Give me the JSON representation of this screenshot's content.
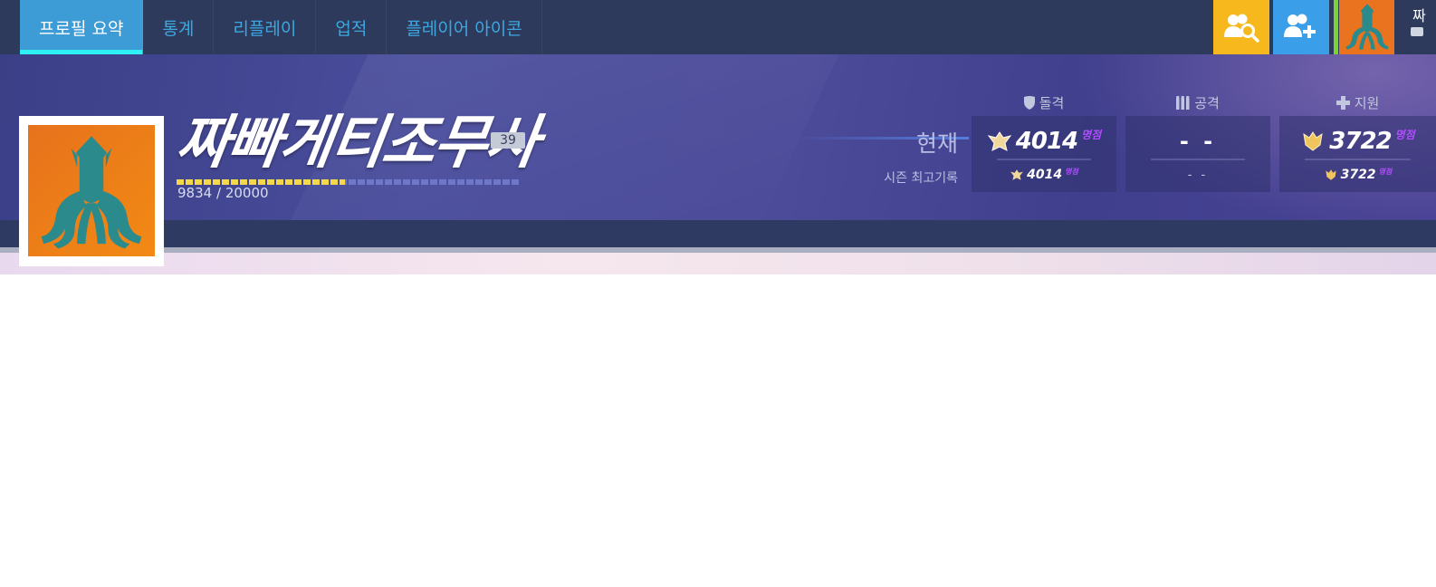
{
  "nav": {
    "tabs": [
      {
        "label": "프로필 요약",
        "active": true
      },
      {
        "label": "통계",
        "active": false
      },
      {
        "label": "리플레이",
        "active": false
      },
      {
        "label": "업적",
        "active": false
      },
      {
        "label": "플레이어 아이콘",
        "active": false
      }
    ]
  },
  "topbar": {
    "user_name_partial": "짜",
    "colors": {
      "search_button": "#f6b81d",
      "add_friend_button": "#3a9ee8",
      "online_status": "#7bd233"
    }
  },
  "profile": {
    "name": "짜빠게티조무사",
    "level": "39",
    "xp_current": "9834",
    "xp_separator": "/",
    "xp_total": "20000",
    "xp_progress": 0.4917,
    "icon": "kraken-icon"
  },
  "competitive": {
    "row_labels": {
      "current": "현재",
      "season_best": "시즌 최고기록"
    },
    "roles": [
      {
        "name": "돌격",
        "icon": "shield-icon",
        "current": "4014",
        "current_tier": "명점",
        "best": "4014",
        "best_tier": "명점",
        "rank_icon": "grandmaster-rank-icon"
      },
      {
        "name": "공격",
        "icon": "ammo-icon",
        "current": "- -",
        "current_tier": "",
        "best": "- -",
        "best_tier": "",
        "rank_icon": ""
      },
      {
        "name": "지원",
        "icon": "cross-icon",
        "current": "3722",
        "current_tier": "명점",
        "best": "3722",
        "best_tier": "명점",
        "rank_icon": "master-rank-icon"
      }
    ]
  }
}
